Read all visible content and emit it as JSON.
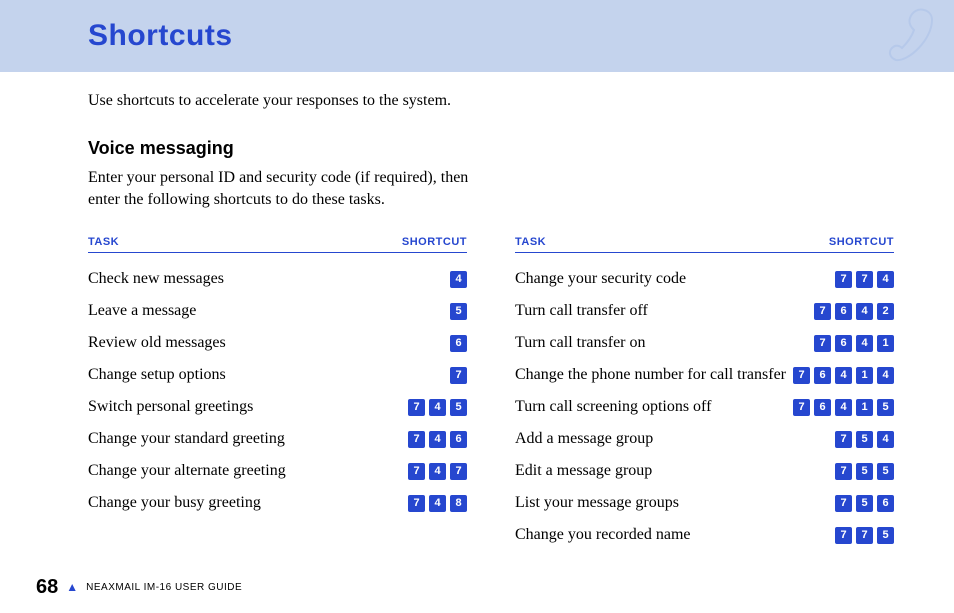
{
  "header": {
    "title": "Shortcuts"
  },
  "intro": "Use shortcuts to accelerate your responses to the system.",
  "section": {
    "heading": "Voice messaging",
    "description": "Enter your personal ID and security code (if required), then enter the following shortcuts to do these tasks."
  },
  "table_headers": {
    "task": "TASK",
    "shortcut": "SHORTCUT"
  },
  "left_rows": [
    {
      "task": "Check new messages",
      "keys": [
        "4"
      ]
    },
    {
      "task": "Leave a message",
      "keys": [
        "5"
      ]
    },
    {
      "task": "Review old messages",
      "keys": [
        "6"
      ]
    },
    {
      "task": "Change setup options",
      "keys": [
        "7"
      ]
    },
    {
      "task": "Switch personal greetings",
      "keys": [
        "7",
        "4",
        "5"
      ]
    },
    {
      "task": "Change your standard greeting",
      "keys": [
        "7",
        "4",
        "6"
      ]
    },
    {
      "task": "Change your alternate greeting",
      "keys": [
        "7",
        "4",
        "7"
      ]
    },
    {
      "task": "Change your busy greeting",
      "keys": [
        "7",
        "4",
        "8"
      ]
    }
  ],
  "right_rows": [
    {
      "task": "Change your security code",
      "keys": [
        "7",
        "7",
        "4"
      ]
    },
    {
      "task": "Turn call transfer off",
      "keys": [
        "7",
        "6",
        "4",
        "2"
      ]
    },
    {
      "task": "Turn call transfer on",
      "keys": [
        "7",
        "6",
        "4",
        "1"
      ]
    },
    {
      "task": "Change the phone number for call transfer",
      "keys": [
        "7",
        "6",
        "4",
        "1",
        "4"
      ]
    },
    {
      "task": "Turn call screening options off",
      "keys": [
        "7",
        "6",
        "4",
        "1",
        "5"
      ]
    },
    {
      "task": "Add a message group",
      "keys": [
        "7",
        "5",
        "4"
      ]
    },
    {
      "task": "Edit a message group",
      "keys": [
        "7",
        "5",
        "5"
      ]
    },
    {
      "task": "List your message groups",
      "keys": [
        "7",
        "5",
        "6"
      ]
    },
    {
      "task": "Change you recorded name",
      "keys": [
        "7",
        "7",
        "5"
      ]
    }
  ],
  "footer": {
    "page_number": "68",
    "guide_name": "NEAXMAIL IM-16 USER GUIDE"
  }
}
